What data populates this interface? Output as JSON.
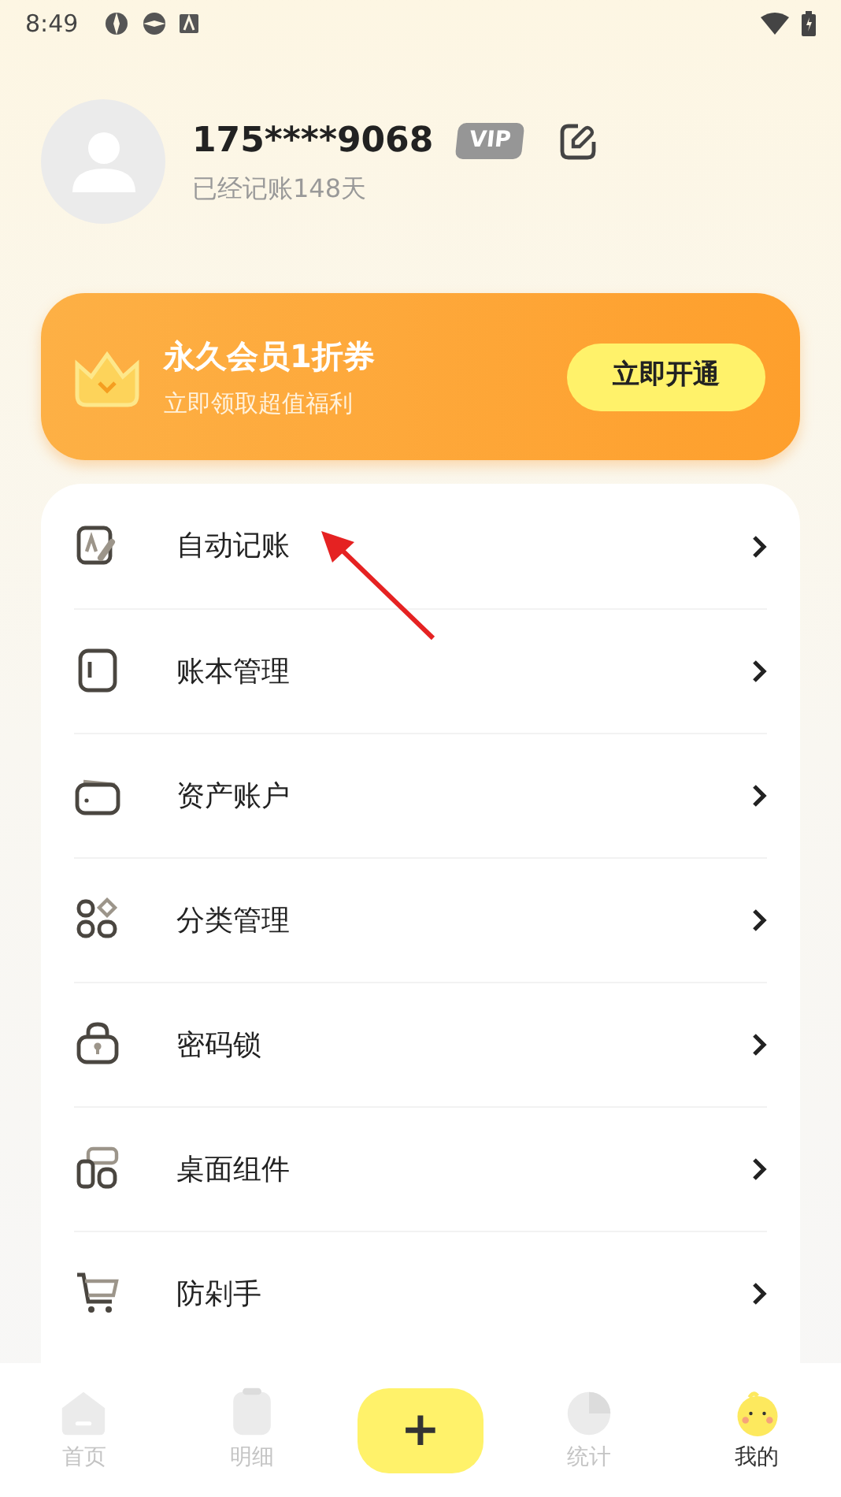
{
  "status_bar": {
    "time": "8:49"
  },
  "profile": {
    "phone": "175****9068",
    "badge": "VIP",
    "subtitle": "已经记账148天"
  },
  "promo": {
    "title": "永久会员1折券",
    "subtitle": "立即领取超值福利",
    "button": "立即开通"
  },
  "menu": [
    {
      "kind": "auto",
      "label": "自动记账"
    },
    {
      "kind": "book",
      "label": "账本管理"
    },
    {
      "kind": "wallet",
      "label": "资产账户"
    },
    {
      "kind": "category",
      "label": "分类管理"
    },
    {
      "kind": "lock",
      "label": "密码锁"
    },
    {
      "kind": "widget",
      "label": "桌面组件"
    },
    {
      "kind": "cart",
      "label": "防剁手"
    }
  ],
  "tab_bar": [
    {
      "kind": "home",
      "label": "首页",
      "selected": false
    },
    {
      "kind": "detail",
      "label": "明细",
      "selected": false
    },
    {
      "kind": "add",
      "label": "+",
      "selected": false
    },
    {
      "kind": "stats",
      "label": "统计",
      "selected": false
    },
    {
      "kind": "me",
      "label": "我的",
      "selected": true
    }
  ]
}
